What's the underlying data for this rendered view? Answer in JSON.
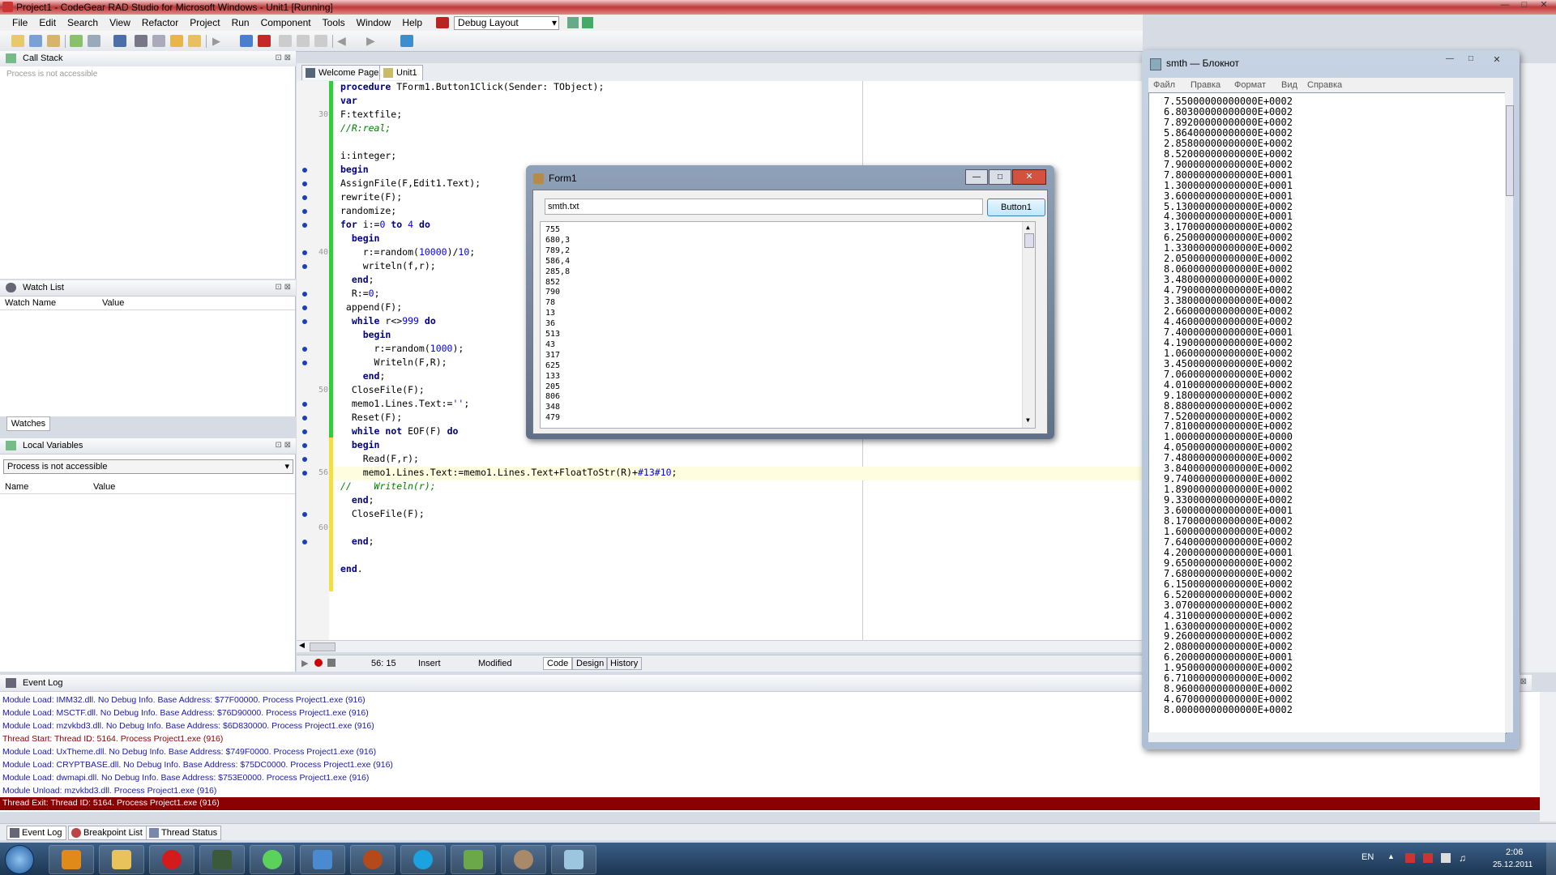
{
  "window": {
    "title": "Project1 - CodeGear RAD Studio for Microsoft Windows - Unit1 [Running]"
  },
  "menu": [
    "File",
    "Edit",
    "Search",
    "View",
    "Refactor",
    "Project",
    "Run",
    "Component",
    "Tools",
    "Window",
    "Help"
  ],
  "layout_select": "Debug Layout",
  "call_stack": {
    "title": "Call Stack",
    "note": "Process is not accessible"
  },
  "watch_list": {
    "title": "Watch List",
    "col_name": "Watch Name",
    "col_value": "Value",
    "tab": "Watches"
  },
  "local_vars": {
    "title": "Local Variables",
    "select": "Process is not accessible",
    "col_name": "Name",
    "col_value": "Value"
  },
  "editor_tabs": [
    "Welcome Page",
    "Unit1"
  ],
  "line_numbers": [
    "30",
    "40",
    "50",
    "56",
    "60"
  ],
  "code": [
    "procedure TForm1.Button1Click(Sender: TObject);",
    "var",
    "F:textfile;",
    "//R:real;",
    "",
    "i:integer;",
    "begin",
    "AssignFile(F,Edit1.Text);",
    "rewrite(F);",
    "randomize;",
    "for i:=0 to 4 do",
    "  begin",
    "    r:=random(10000)/10;",
    "    writeln(f,r);",
    "  end;",
    "  R:=0;",
    " append(F);",
    "  while r<>999 do",
    "    begin",
    "      r:=random(1000);",
    "      Writeln(F,R);",
    "    end;",
    "  CloseFile(F);",
    "  memo1.Lines.Text:='';",
    "  Reset(F);",
    "  while not EOF(F) do",
    "  begin",
    "    Read(F,r);",
    "    memo1.Lines.Text:=memo1.Lines.Text+FloatToStr(R)+#13#10;",
    "//    Writeln(r);",
    "  end;",
    "  CloseFile(F);",
    "",
    "  end;",
    "",
    "end."
  ],
  "status": {
    "position": "56: 15",
    "mode": "Insert",
    "state": "Modified",
    "tabs": [
      "Code",
      "Design",
      "History"
    ]
  },
  "form1": {
    "title": "Form1",
    "edit_value": "smth.txt",
    "button": "Button1",
    "memo_lines": [
      "755",
      "680,3",
      "789,2",
      "586,4",
      "285,8",
      "852",
      "790",
      "78",
      "13",
      "36",
      "513",
      "43",
      "317",
      "625",
      "133",
      "205",
      "806",
      "348",
      "479"
    ]
  },
  "notepad": {
    "title": "smth — Блокнот",
    "menu": [
      "Файл",
      "Правка",
      "Формат",
      "Вид",
      "Справка"
    ],
    "lines": [
      "7.55000000000000E+0002",
      "6.80300000000000E+0002",
      "7.89200000000000E+0002",
      "5.86400000000000E+0002",
      "2.85800000000000E+0002",
      "8.52000000000000E+0002",
      "7.90000000000000E+0002",
      "7.80000000000000E+0001",
      "1.30000000000000E+0001",
      "3.60000000000000E+0001",
      "5.13000000000000E+0002",
      "4.30000000000000E+0001",
      "3.17000000000000E+0002",
      "6.25000000000000E+0002",
      "1.33000000000000E+0002",
      "2.05000000000000E+0002",
      "8.06000000000000E+0002",
      "3.48000000000000E+0002",
      "4.79000000000000E+0002",
      "3.38000000000000E+0002",
      "2.66000000000000E+0002",
      "4.46000000000000E+0002",
      "7.40000000000000E+0001",
      "4.19000000000000E+0002",
      "1.06000000000000E+0002",
      "3.45000000000000E+0002",
      "7.06000000000000E+0002",
      "4.01000000000000E+0002",
      "9.18000000000000E+0002",
      "8.88000000000000E+0002",
      "7.52000000000000E+0002",
      "7.81000000000000E+0002",
      "1.00000000000000E+0000",
      "4.05000000000000E+0002",
      "7.48000000000000E+0002",
      "3.84000000000000E+0002",
      "9.74000000000000E+0002",
      "1.89000000000000E+0002",
      "9.33000000000000E+0002",
      "3.60000000000000E+0001",
      "8.17000000000000E+0002",
      "1.60000000000000E+0002",
      "7.64000000000000E+0002",
      "4.20000000000000E+0001",
      "9.65000000000000E+0002",
      "7.68000000000000E+0002",
      "6.15000000000000E+0002",
      "6.52000000000000E+0002",
      "3.07000000000000E+0002",
      "4.31000000000000E+0002",
      "1.63000000000000E+0002",
      "9.26000000000000E+0002",
      "2.08000000000000E+0002",
      "6.20000000000000E+0001",
      "1.95000000000000E+0002",
      "6.71000000000000E+0002",
      "8.96000000000000E+0002",
      "4.67000000000000E+0002",
      "8.00000000000000E+0002"
    ]
  },
  "event_log": {
    "title": "Event Log",
    "lines": [
      "Module Load: IMM32.dll. No Debug Info. Base Address: $77F00000. Process Project1.exe (916)",
      "Module Load: MSCTF.dll. No Debug Info. Base Address: $76D90000. Process Project1.exe (916)",
      "Module Load: mzvkbd3.dll. No Debug Info. Base Address: $6D830000. Process Project1.exe (916)",
      "Thread Start: Thread ID: 5164. Process Project1.exe (916)",
      "Module Load: UxTheme.dll. No Debug Info. Base Address: $749F0000. Process Project1.exe (916)",
      "Module Load: CRYPTBASE.dll. No Debug Info. Base Address: $75DC0000. Process Project1.exe (916)",
      "Module Load: dwmapi.dll. No Debug Info. Base Address: $753E0000. Process Project1.exe (916)",
      "Module Unload: mzvkbd3.dll. Process Project1.exe (916)",
      "Thread Exit: Thread ID: 5164. Process Project1.exe (916)"
    ],
    "tabs": [
      "Event Log",
      "Breakpoint List",
      "Thread Status"
    ]
  },
  "tray": {
    "lang": "EN",
    "time": "2:06",
    "date": "25.12.2011"
  },
  "colors": {
    "change_bar": "#2fcf3a",
    "breakpoint": "#1a3fb8",
    "selected_log": "#8b0000",
    "keyword": "#000080"
  }
}
